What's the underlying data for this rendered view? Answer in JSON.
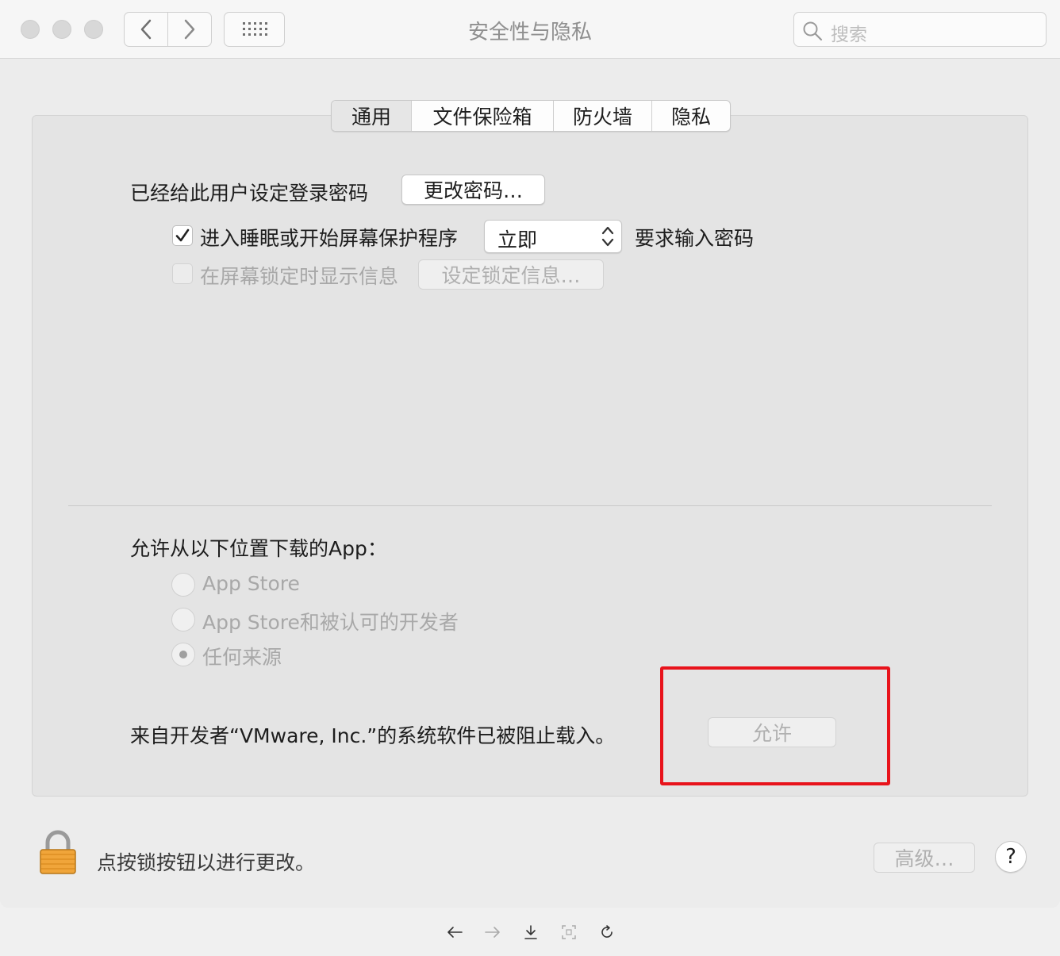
{
  "window": {
    "title": "安全性与隐私",
    "search": {
      "placeholder": "搜索"
    }
  },
  "tabs": [
    {
      "label": "通用",
      "selected": true
    },
    {
      "label": "文件保险箱",
      "selected": false
    },
    {
      "label": "防火墙",
      "selected": false
    },
    {
      "label": "隐私",
      "selected": false
    }
  ],
  "general": {
    "password_label": "已经给此用户设定登录密码",
    "change_password_button": "更改密码…",
    "require_password": {
      "checked": true,
      "label": "进入睡眠或开始屏幕保护程序",
      "delay_value": "立即",
      "suffix": "要求输入密码"
    },
    "lock_message": {
      "checked": false,
      "label": "在屏幕锁定时显示信息",
      "button": "设定锁定信息…"
    }
  },
  "downloads": {
    "heading": "允许从以下位置下载的App：",
    "options": [
      {
        "label": "App Store",
        "selected": false
      },
      {
        "label": "App Store和被认可的开发者",
        "selected": false
      },
      {
        "label": "任何来源",
        "selected": true
      }
    ]
  },
  "blocked": {
    "message": "来自开发者“VMware, Inc.”的系统软件已被阻止载入。",
    "allow_button": "允许",
    "highlight_color": "#e8131b"
  },
  "footer": {
    "lock_text": "点按锁按钮以进行更改。",
    "advanced_button": "高级…",
    "help_button": "?"
  }
}
